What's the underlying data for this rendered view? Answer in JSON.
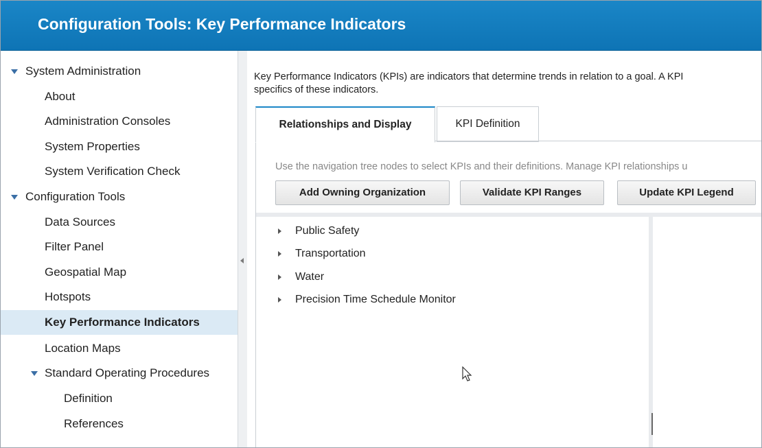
{
  "header": {
    "title": "Configuration Tools: Key Performance Indicators"
  },
  "sidebar": {
    "items": [
      {
        "label": "System Administration",
        "level": 0,
        "expanded": true
      },
      {
        "label": "About",
        "level": 1
      },
      {
        "label": "Administration Consoles",
        "level": 1
      },
      {
        "label": "System Properties",
        "level": 1
      },
      {
        "label": "System Verification Check",
        "level": 1
      },
      {
        "label": "Configuration Tools",
        "level": 0,
        "expanded": true
      },
      {
        "label": "Data Sources",
        "level": 1
      },
      {
        "label": "Filter Panel",
        "level": 1
      },
      {
        "label": "Geospatial Map",
        "level": 1
      },
      {
        "label": "Hotspots",
        "level": 1
      },
      {
        "label": "Key Performance Indicators",
        "level": 1,
        "selected": true
      },
      {
        "label": "Location Maps",
        "level": 1
      },
      {
        "label": "Standard Operating Procedures",
        "level": 1,
        "expanded": true
      },
      {
        "label": "Definition",
        "level": 2
      },
      {
        "label": "References",
        "level": 2
      }
    ]
  },
  "main": {
    "intro_line1": "Key Performance Indicators (KPIs) are indicators that determine trends in relation to a goal. A KPI",
    "intro_line2": "specifics of these indicators.",
    "tabs": [
      {
        "label": "Relationships and Display",
        "active": true
      },
      {
        "label": "KPI Definition",
        "active": false
      }
    ],
    "help_text": "Use the navigation tree nodes to select KPIs and their definitions. Manage KPI relationships u",
    "buttons": {
      "add_owning_org": "Add Owning Organization",
      "validate_ranges": "Validate KPI Ranges",
      "update_legend": "Update KPI Legend"
    },
    "tree": [
      {
        "label": "Public Safety"
      },
      {
        "label": "Transportation"
      },
      {
        "label": "Water"
      },
      {
        "label": "Precision Time Schedule Monitor"
      }
    ]
  },
  "colors": {
    "header_bg": "#1a86c7",
    "selected_bg": "#dbeaf5",
    "caret": "#3b6fa6"
  },
  "icons": [
    "expand-caret-icon",
    "collapse-splitter-icon",
    "tree-expand-icon",
    "mouse-pointer-icon"
  ]
}
